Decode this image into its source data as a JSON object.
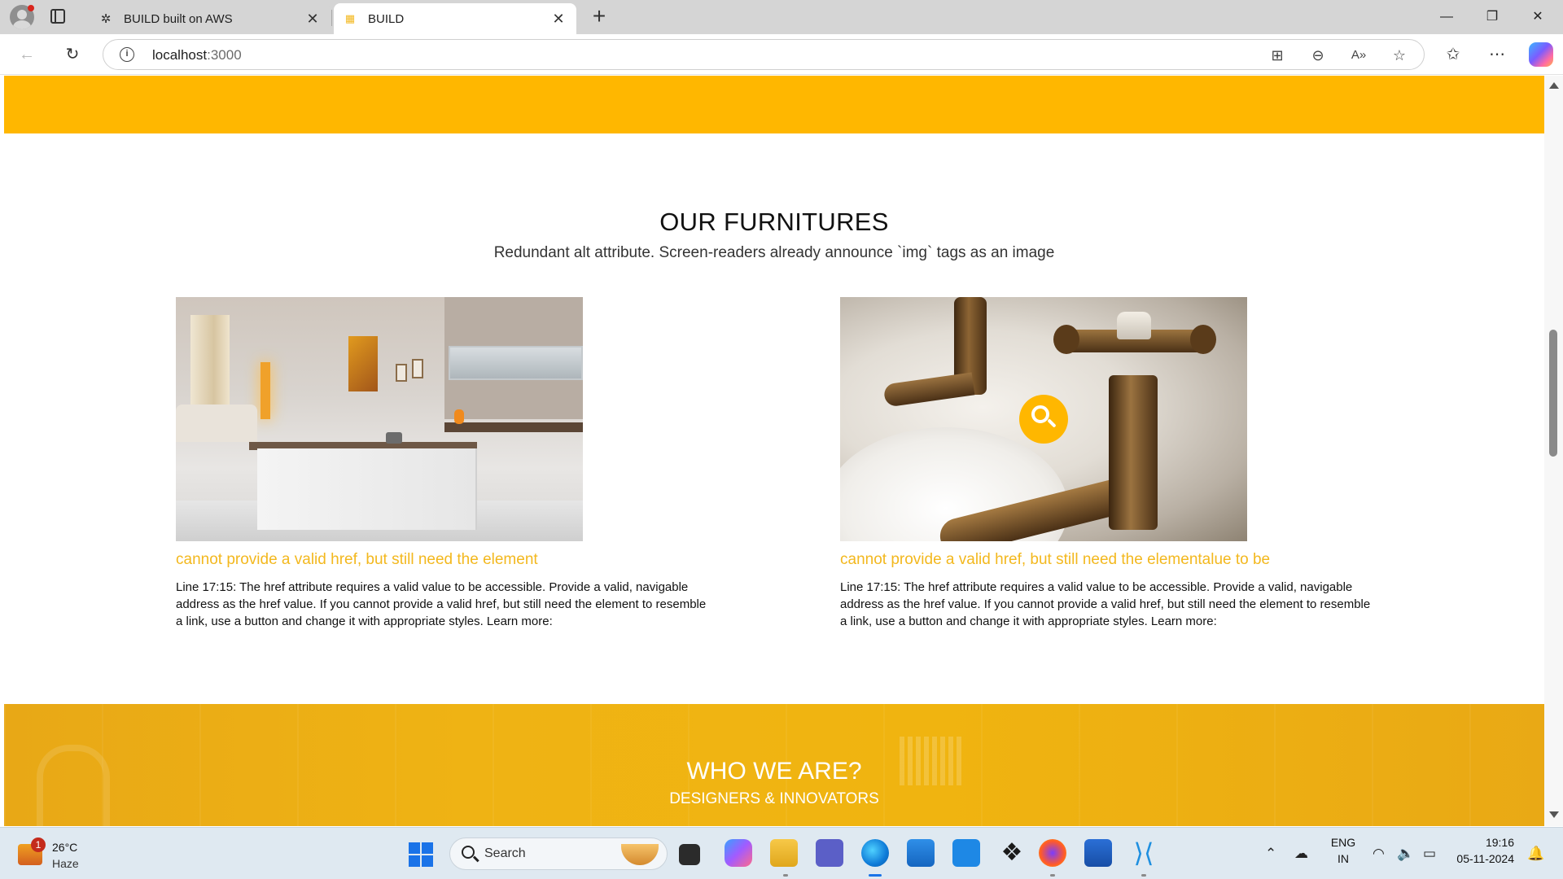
{
  "browser": {
    "tabs": [
      {
        "label": "BUILD built on AWS",
        "favicon": "openai-favicon-icon",
        "active": false
      },
      {
        "label": "BUILD",
        "favicon": "build-favicon-icon",
        "active": true
      }
    ],
    "new_tab_label": "+",
    "address": {
      "host": "localhost",
      "port": ":3000"
    }
  },
  "page": {
    "section_title": "OUR FURNITURES",
    "section_subtitle": "Redundant alt attribute. Screen-readers already announce `img` tags as an image",
    "cards": [
      {
        "title": "cannot provide a valid href, but still need the element",
        "text": "Line 17:15: The href attribute requires a valid value to be accessible. Provide a valid, navigable address as the href value. If you cannot provide a valid href, but still need the element to resemble a link, use a button and change it with appropriate styles. Learn more:"
      },
      {
        "title": "cannot provide a valid href, but still need the elementalue to be",
        "text": "Line 17:15: The href attribute requires a valid value to be accessible. Provide a valid, navigable address as the href value. If you cannot provide a valid href, but still need the element to resemble a link, use a button and change it with appropriate styles. Learn more:"
      }
    ],
    "who_title": "WHO WE ARE?",
    "who_subtitle": "DESIGNERS & INNOVATORS"
  },
  "taskbar": {
    "weather": {
      "badge": "1",
      "temp": "26°C",
      "condition": "Haze"
    },
    "search_label": "Search",
    "lang": "ENG",
    "region": "IN",
    "time": "19:16",
    "date": "05-11-2024"
  },
  "colors": {
    "accent_yellow": "#ffb700",
    "card_title": "#f3b81e"
  }
}
